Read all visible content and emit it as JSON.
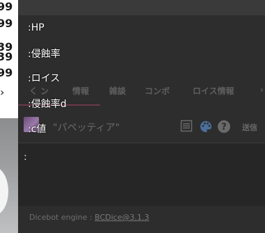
{
  "background_numbers": [
    "99",
    "99",
    "39",
    "39",
    "99"
  ],
  "background_chevron": "›",
  "autocomplete": {
    "items": [
      ":HP",
      ":侵蝕率",
      ":ロイス",
      ":侵蝕率d",
      ":c値"
    ]
  },
  "tabs": [
    {
      "label": "く ン"
    },
    {
      "label": "情報"
    },
    {
      "label": "雑談"
    },
    {
      "label": "コンボ"
    },
    {
      "label": "ロイス情報"
    },
    {
      "label": "›"
    }
  ],
  "chat": {
    "character_name": "\"パペッティア\"",
    "send_label": "送信",
    "input_value": ":"
  },
  "footer": {
    "prefix": "Dicebot engine : ",
    "link": "BCDice@3.1.3"
  },
  "colors": {
    "panel_bg": "#2d2d2d",
    "accent_underline": "#6b3a4a"
  }
}
